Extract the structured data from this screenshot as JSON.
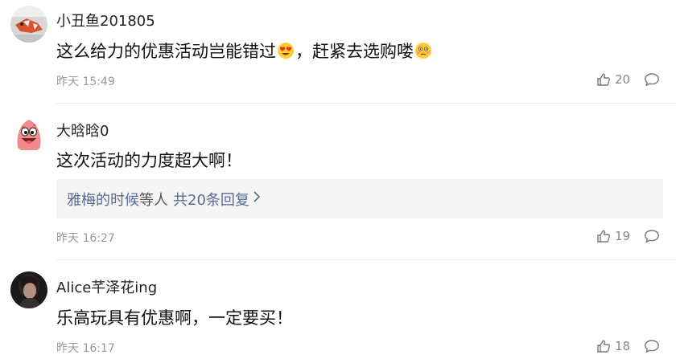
{
  "comments": [
    {
      "username": "小丑鱼201805",
      "text_part1": "这么给力的优惠活动岂能错过",
      "emoji1": "heart-eyes-emoji",
      "text_part2": "，赶紧去选购喽",
      "emoji2": "flushed-face-emoji",
      "time": "昨天 15:49",
      "likes": "20"
    },
    {
      "username": "大晗晗0",
      "text": "这次活动的力度超大啊！",
      "reply_users": "雅梅的时候",
      "reply_middle": "等人",
      "reply_count": "共20条回复",
      "time": "昨天 16:27",
      "likes": "19"
    },
    {
      "username": "Alice芊泽花ing",
      "text": "乐高玩具有优惠啊，一定要买！",
      "time": "昨天 16:17",
      "likes": "18"
    }
  ],
  "colors": {
    "link": "#576b95",
    "meta": "#999999",
    "reply_bg": "#f5f5f5"
  }
}
